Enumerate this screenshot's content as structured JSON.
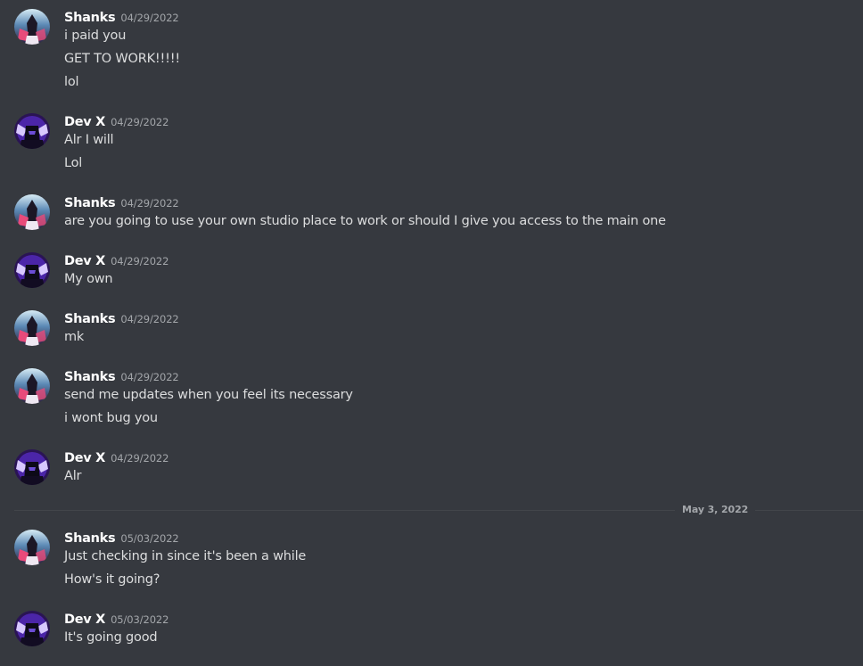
{
  "users": {
    "shanks": {
      "name": "Shanks",
      "avatar_icon": "shanks-avatar-icon"
    },
    "devx": {
      "name": "Dev X",
      "avatar_icon": "devx-avatar-icon"
    }
  },
  "messages": [
    {
      "author": "Shanks",
      "timestamp": "04/29/2022",
      "lines": [
        "i paid you",
        "GET TO WORK!!!!!",
        "lol"
      ]
    },
    {
      "author": "Dev X",
      "timestamp": "04/29/2022",
      "lines": [
        "Alr I will",
        "Lol"
      ]
    },
    {
      "author": "Shanks",
      "timestamp": "04/29/2022",
      "lines": [
        "are you going to use your own studio place to work or should I give you access to the main one"
      ]
    },
    {
      "author": "Dev X",
      "timestamp": "04/29/2022",
      "lines": [
        "My own"
      ]
    },
    {
      "author": "Shanks",
      "timestamp": "04/29/2022",
      "lines": [
        "mk"
      ]
    },
    {
      "author": "Shanks",
      "timestamp": "04/29/2022",
      "lines": [
        "send me updates when you feel its necessary",
        "i wont bug you"
      ]
    },
    {
      "author": "Dev X",
      "timestamp": "04/29/2022",
      "lines": [
        "Alr"
      ]
    },
    {
      "author": "Shanks",
      "timestamp": "05/03/2022",
      "lines": [
        "Just checking in since it's been a while",
        "How's it going?"
      ]
    },
    {
      "author": "Dev X",
      "timestamp": "05/03/2022",
      "lines": [
        "It's going good"
      ]
    }
  ],
  "date_divider": {
    "label": "May 3, 2022"
  },
  "colors": {
    "background": "#36393f",
    "username": "#ffffff",
    "message_text": "#dcddde",
    "timestamp": "#a3a6aa",
    "divider": "#42454a"
  }
}
